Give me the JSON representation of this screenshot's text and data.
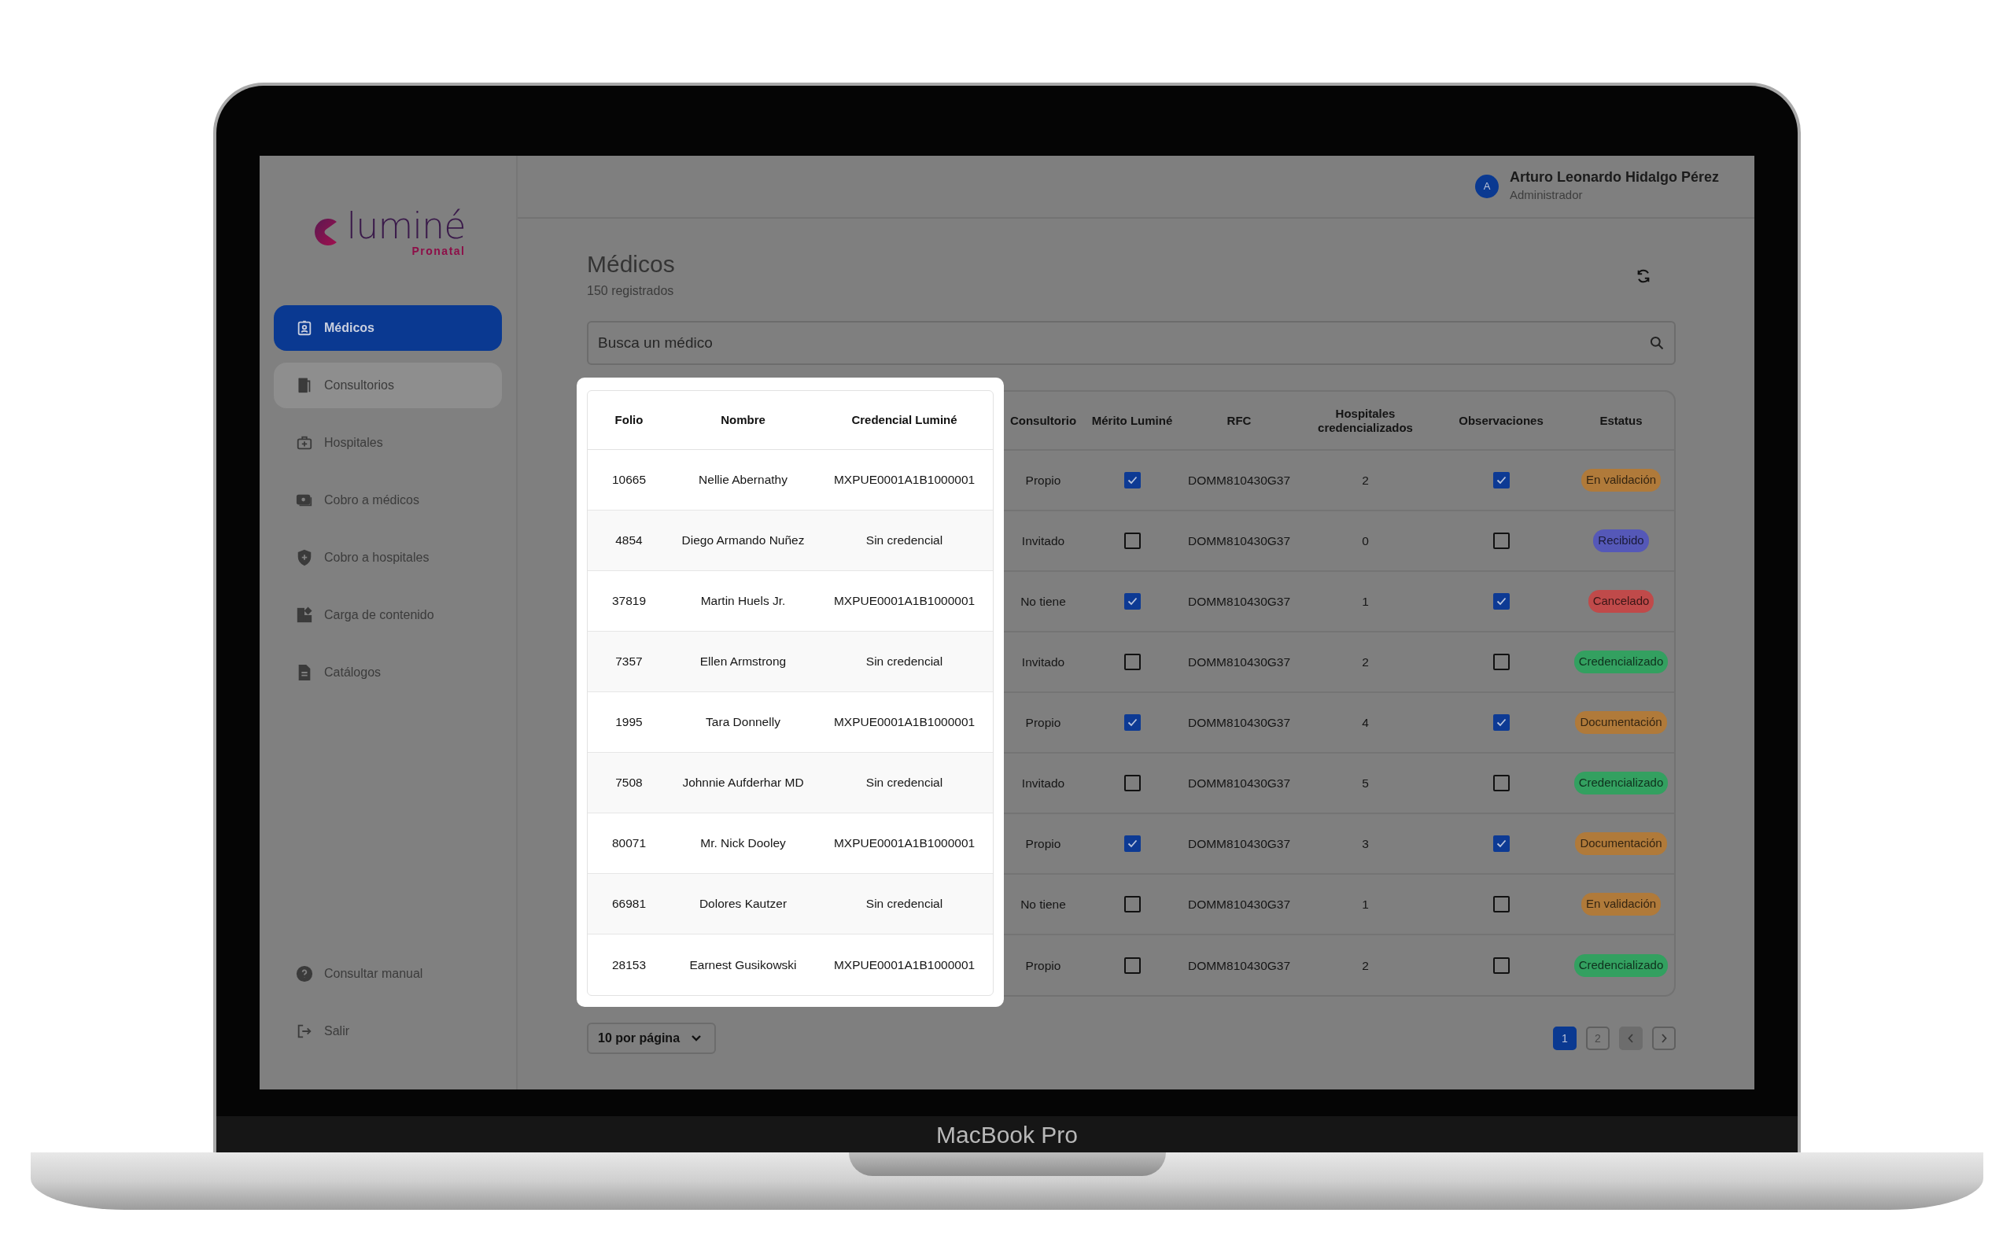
{
  "device": {
    "label": "MacBook Pro"
  },
  "sidebar": {
    "logo": {
      "name": "luminé",
      "tagline": "Pronatal"
    },
    "items": [
      {
        "label": "Médicos",
        "selected": true,
        "hovered": false
      },
      {
        "label": "Consultorios",
        "selected": false,
        "hovered": true
      },
      {
        "label": "Hospitales",
        "selected": false,
        "hovered": false
      },
      {
        "label": "Cobro a médicos",
        "selected": false,
        "hovered": false
      },
      {
        "label": "Cobro a hospitales",
        "selected": false,
        "hovered": false
      },
      {
        "label": "Carga de contenido",
        "selected": false,
        "hovered": false
      },
      {
        "label": "Catálogos",
        "selected": false,
        "hovered": false
      }
    ],
    "footer_items": [
      {
        "label": "Consultar manual"
      },
      {
        "label": "Salir"
      }
    ]
  },
  "user": {
    "initial": "A",
    "name": "Arturo Leonardo Hidalgo Pérez",
    "role": "Administrador"
  },
  "page": {
    "title": "Médicos",
    "subtitle": "150 registrados"
  },
  "search": {
    "placeholder": "Busca un médico"
  },
  "table": {
    "columns": [
      {
        "label": "Folio",
        "highlighted": true
      },
      {
        "label": "Nombre",
        "highlighted": true
      },
      {
        "label": "Credencial Luminé",
        "highlighted": true
      },
      {
        "label": "Consultorio",
        "highlighted": false
      },
      {
        "label": "Mérito Luminé",
        "highlighted": false
      },
      {
        "label": "RFC",
        "highlighted": false
      },
      {
        "label": "Hospitales credencializados",
        "highlighted": false
      },
      {
        "label": "Observaciones",
        "highlighted": false
      },
      {
        "label": "Estatus",
        "highlighted": false
      }
    ],
    "rows": [
      {
        "folio": "10665",
        "nombre": "Nellie Abernathy",
        "credencial": "MXPUE0001A1B1000001",
        "consultorio": "Propio",
        "merito": {
          "checked": true
        },
        "rfc": "DOMM810430G37",
        "hospitales": "2",
        "observaciones": {
          "checked": true
        },
        "estatus": {
          "label": "En validación",
          "color": "#b07a3a"
        }
      },
      {
        "folio": "4854",
        "nombre": "Diego Armando Nuñez",
        "credencial": "Sin credencial",
        "consultorio": "Invitado",
        "merito": {
          "checked": false
        },
        "rfc": "DOMM810430G37",
        "hospitales": "0",
        "observaciones": {
          "checked": false
        },
        "estatus": {
          "label": "Recibido",
          "color": "#5558b8"
        }
      },
      {
        "folio": "37819",
        "nombre": "Martin Huels Jr.",
        "credencial": "MXPUE0001A1B1000001",
        "consultorio": "No tiene",
        "merito": {
          "checked": true
        },
        "rfc": "DOMM810430G37",
        "hospitales": "1",
        "observaciones": {
          "checked": true
        },
        "estatus": {
          "label": "Cancelado",
          "color": "#c04a4a"
        }
      },
      {
        "folio": "7357",
        "nombre": "Ellen Armstrong",
        "credencial": "Sin credencial",
        "consultorio": "Invitado",
        "merito": {
          "checked": false
        },
        "rfc": "DOMM810430G37",
        "hospitales": "2",
        "observaciones": {
          "checked": false
        },
        "estatus": {
          "label": "Credencializado",
          "color": "#33a060"
        }
      },
      {
        "folio": "1995",
        "nombre": "Tara Donnelly",
        "credencial": "MXPUE0001A1B1000001",
        "consultorio": "Propio",
        "merito": {
          "checked": true
        },
        "rfc": "DOMM810430G37",
        "hospitales": "4",
        "observaciones": {
          "checked": true
        },
        "estatus": {
          "label": "Documentación",
          "color": "#b07a3a"
        }
      },
      {
        "folio": "7508",
        "nombre": "Johnnie Aufderhar MD",
        "credencial": "Sin credencial",
        "consultorio": "Invitado",
        "merito": {
          "checked": false
        },
        "rfc": "DOMM810430G37",
        "hospitales": "5",
        "observaciones": {
          "checked": false
        },
        "estatus": {
          "label": "Credencializado",
          "color": "#33a060"
        }
      },
      {
        "folio": "80071",
        "nombre": "Mr. Nick Dooley",
        "credencial": "MXPUE0001A1B1000001",
        "consultorio": "Propio",
        "merito": {
          "checked": true
        },
        "rfc": "DOMM810430G37",
        "hospitales": "3",
        "observaciones": {
          "checked": true
        },
        "estatus": {
          "label": "Documentación",
          "color": "#b07a3a"
        }
      },
      {
        "folio": "66981",
        "nombre": "Dolores Kautzer",
        "credencial": "Sin credencial",
        "consultorio": "No tiene",
        "merito": {
          "checked": false
        },
        "rfc": "DOMM810430G37",
        "hospitales": "1",
        "observaciones": {
          "checked": false
        },
        "estatus": {
          "label": "En validación",
          "color": "#b07a3a"
        }
      },
      {
        "folio": "28153",
        "nombre": "Earnest Gusikowski",
        "credencial": "MXPUE0001A1B1000001",
        "consultorio": "Propio",
        "merito": {
          "checked": false
        },
        "rfc": "DOMM810430G37",
        "hospitales": "2",
        "observaciones": {
          "checked": false
        },
        "estatus": {
          "label": "Credencializado",
          "color": "#33a060"
        }
      }
    ]
  },
  "pagination": {
    "per_page": "10 por página",
    "pages": [
      {
        "label": "1",
        "selected": true
      },
      {
        "label": "2",
        "selected": false
      }
    ],
    "prev": {
      "disabled": true
    },
    "next": {
      "disabled": false
    }
  }
}
